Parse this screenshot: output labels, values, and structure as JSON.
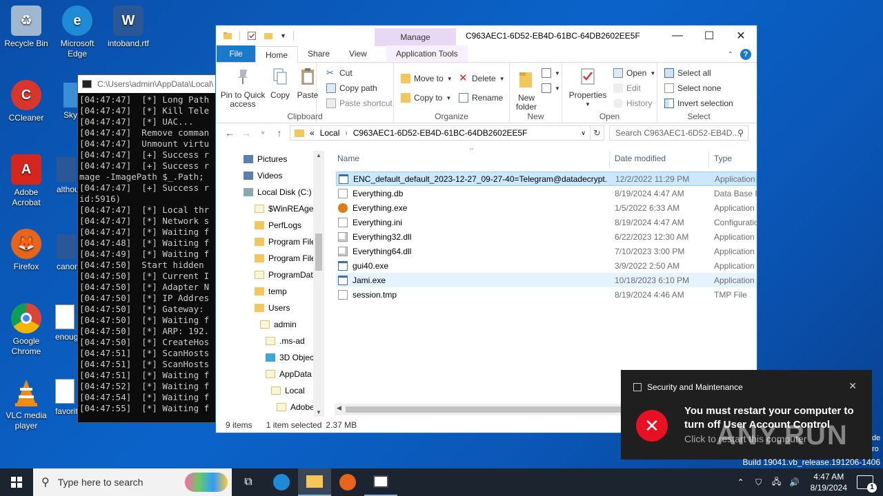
{
  "desktop": {
    "icons": [
      {
        "label": "Recycle Bin",
        "icon": "recycle-bin-icon",
        "color": "#9fb8d0"
      },
      {
        "label": "Microsoft Edge",
        "icon": "edge-icon",
        "color": "#1f8ad6"
      },
      {
        "label": "intoband.rtf",
        "icon": "word-doc-icon",
        "color": "#2b5797"
      },
      {
        "label": "CCleaner",
        "icon": "ccleaner-icon",
        "color": "#d9362b"
      },
      {
        "label": "Adobe Acrobat",
        "icon": "acrobat-icon",
        "color": "#d4261c"
      },
      {
        "label": "Firefox",
        "icon": "firefox-icon",
        "color": "#e8641c"
      },
      {
        "label": "Google Chrome",
        "icon": "chrome-icon",
        "color": "#2a9d4a"
      },
      {
        "label": "VLC media player",
        "icon": "vlc-icon",
        "color": "#f08b14"
      }
    ],
    "partial_labels": [
      "Sky",
      "althou",
      "canon",
      "enoug",
      "favorit"
    ]
  },
  "console": {
    "title": "C:\\Users\\admin\\AppData\\Local\\",
    "lines": [
      "[04:47:47]  [*] Long Path",
      "[04:47:47]  [*] Kill Tele",
      "[04:47:47]  [*] UAC...",
      "[04:47:47]  Remove comman",
      "[04:47:47]  Unmount virtu",
      "[04:47:47]  [+] Success r",
      "[04:47:47]  [+] Success r",
      "mage -ImagePath $_.Path;",
      "[04:47:47]  [+] Success r",
      "id:5916)",
      "[04:47:47]  [*] Local thr",
      "[04:47:47]  [*] Network s",
      "[04:47:47]  [*] Waiting f",
      "[04:47:48]  [*] Waiting f",
      "[04:47:49]  [*] Waiting f",
      "[04:47:50]  Start hidden",
      "[04:47:50]  [*] Current I",
      "[04:47:50]  [*] Adapter N",
      "[04:47:50]  [*] IP Addres",
      "[04:47:50]  [*] Gateway:",
      "[04:47:50]  [*] Waiting f",
      "[04:47:50]  [*] ARP: 192.",
      "[04:47:50]  [*] CreateHos",
      "[04:47:51]  [*] ScanHosts",
      "[04:47:51]  [*] ScanHosts",
      "[04:47:51]  [*] Waiting f",
      "[04:47:52]  [*] Waiting f",
      "[04:47:54]  [*] Waiting f",
      "[04:47:55]  [*] Waiting f"
    ]
  },
  "explorer": {
    "title": "C963AEC1-6D52-EB4D-61BC-64DB2602EE5F",
    "manage": "Manage",
    "tabs": {
      "file": "File",
      "home": "Home",
      "share": "Share",
      "view": "View",
      "app_tools": "Application Tools"
    },
    "ribbon": {
      "pin": "Pin to Quick access",
      "copy": "Copy",
      "paste": "Paste",
      "cut": "Cut",
      "copy_path": "Copy path",
      "paste_shortcut": "Paste shortcut",
      "clipboard": "Clipboard",
      "move_to": "Move to",
      "copy_to": "Copy to",
      "delete": "Delete",
      "rename": "Rename",
      "organize": "Organize",
      "new_folder": "New folder",
      "new": "New",
      "properties": "Properties",
      "open": "Open",
      "edit": "Edit",
      "history": "History",
      "open_group": "Open",
      "select_all": "Select all",
      "select_none": "Select none",
      "invert": "Invert selection",
      "select": "Select"
    },
    "address": {
      "crumb1": "Local",
      "crumb2": "C963AEC1-6D52-EB4D-61BC-64DB2602EE5F",
      "prefix": "«"
    },
    "search_placeholder": "Search C963AEC1-6D52-EB4D...",
    "nav": [
      {
        "label": "Pictures",
        "kind": "lib",
        "indent": 0
      },
      {
        "label": "Videos",
        "kind": "lib",
        "indent": 0
      },
      {
        "label": "Local Disk (C:)",
        "kind": "disk",
        "indent": 0
      },
      {
        "label": "$WinREAgent",
        "kind": "white",
        "indent": 1
      },
      {
        "label": "PerfLogs",
        "kind": "folder",
        "indent": 1
      },
      {
        "label": "Program Files",
        "kind": "folder",
        "indent": 1
      },
      {
        "label": "Program Files",
        "kind": "folder",
        "indent": 1
      },
      {
        "label": "ProgramData",
        "kind": "white",
        "indent": 1
      },
      {
        "label": "temp",
        "kind": "folder",
        "indent": 1
      },
      {
        "label": "Users",
        "kind": "folder",
        "indent": 1
      },
      {
        "label": "admin",
        "kind": "white",
        "indent": 2
      },
      {
        "label": ".ms-ad",
        "kind": "white",
        "indent": 3
      },
      {
        "label": "3D Objects",
        "kind": "cube",
        "indent": 3
      },
      {
        "label": "AppData",
        "kind": "white",
        "indent": 3
      },
      {
        "label": "Local",
        "kind": "white",
        "indent": 4
      },
      {
        "label": "Adobe",
        "kind": "white",
        "indent": 5
      }
    ],
    "columns": {
      "name": "Name",
      "date": "Date modified",
      "type": "Type"
    },
    "files": [
      {
        "name": "ENC_default_default_2023-12-27_09-27-40=Telegram@datadecrypt....",
        "date": "12/2/2022 11:29 PM",
        "type": "Application",
        "icon": "exe-window-icon",
        "state": "sel"
      },
      {
        "name": "Everything.db",
        "date": "8/19/2024 4:47 AM",
        "type": "Data Base Fi",
        "icon": "file-icon",
        "state": ""
      },
      {
        "name": "Everything.exe",
        "date": "1/5/2022 6:33 AM",
        "type": "Application",
        "icon": "everything-magnifier-icon",
        "state": ""
      },
      {
        "name": "Everything.ini",
        "date": "8/19/2024 4:47 AM",
        "type": "Configuratio",
        "icon": "settings-file-icon",
        "state": ""
      },
      {
        "name": "Everything32.dll",
        "date": "6/22/2023 12:30 AM",
        "type": "Application",
        "icon": "dll-icon",
        "state": ""
      },
      {
        "name": "Everything64.dll",
        "date": "7/10/2023 3:00 PM",
        "type": "Application",
        "icon": "dll-icon",
        "state": ""
      },
      {
        "name": "gui40.exe",
        "date": "3/9/2022 2:50 AM",
        "type": "Application",
        "icon": "exe-window-icon",
        "state": ""
      },
      {
        "name": "Jami.exe",
        "date": "10/18/2023 6:10 PM",
        "type": "Application",
        "icon": "exe-window-icon",
        "state": "hl"
      },
      {
        "name": "session.tmp",
        "date": "8/19/2024 4:46 AM",
        "type": "TMP File",
        "icon": "file-icon",
        "state": ""
      }
    ],
    "status": {
      "items": "9 items",
      "selected": "1 item selected",
      "size": "2.37 MB"
    }
  },
  "toast": {
    "header": "Security and Maintenance",
    "message": "You must restart your computer to turn off User Account Control",
    "sub": "Click to restart this computer"
  },
  "watermark": "ANY.RUN",
  "build": "Build 19041.vb_release.191206-1406",
  "edge_text": [
    "de",
    "ro"
  ],
  "taskbar": {
    "search_placeholder": "Type here to search",
    "time": "4:47 AM",
    "date": "8/19/2024",
    "notif_count": "1"
  }
}
